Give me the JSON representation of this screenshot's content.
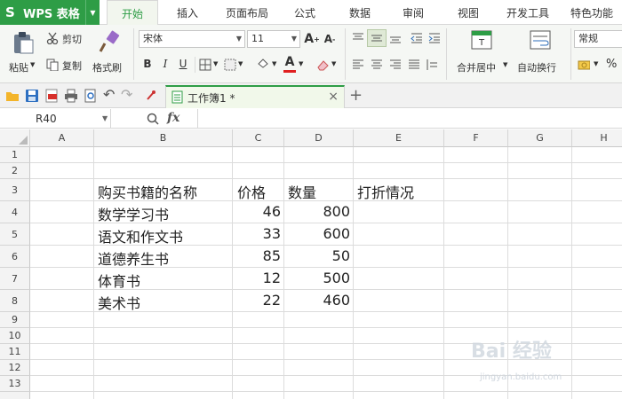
{
  "app": {
    "title": "WPS 表格",
    "logo_letter": "S"
  },
  "menu_tabs": [
    {
      "label": "开始"
    },
    {
      "label": "插入"
    },
    {
      "label": "页面布局"
    },
    {
      "label": "公式"
    },
    {
      "label": "数据"
    },
    {
      "label": "审阅"
    },
    {
      "label": "视图"
    },
    {
      "label": "开发工具"
    },
    {
      "label": "特色功能"
    }
  ],
  "ribbon": {
    "paste": "粘贴",
    "cut": "剪切",
    "copy": "复制",
    "format_painter": "格式刷",
    "font_name": "宋体",
    "font_size": "11",
    "merge_center": "合并居中",
    "wrap_text": "自动换行",
    "number_format": "常规",
    "percent": "%"
  },
  "document_tab": {
    "title": "工作簿1 *"
  },
  "formula_bar": {
    "name_box": "R40",
    "fx": "fx",
    "zoom_icon": "Q"
  },
  "columns": [
    "A",
    "B",
    "C",
    "D",
    "E",
    "F",
    "G",
    "H"
  ],
  "rows": [
    "1",
    "2",
    "3",
    "4",
    "5",
    "6",
    "7",
    "8",
    "9",
    "10",
    "11",
    "12",
    "13"
  ],
  "sheet": {
    "headers": {
      "name": "购买书籍的名称",
      "price": "价格",
      "qty": "数量",
      "discount": "打折情况"
    },
    "records": [
      {
        "name": "数学学习书",
        "price": "46",
        "qty": "800"
      },
      {
        "name": "语文和作文书",
        "price": "33",
        "qty": "600"
      },
      {
        "name": "道德养生书",
        "price": "85",
        "qty": "50"
      },
      {
        "name": "体育书",
        "price": "12",
        "qty": "500"
      },
      {
        "name": "美术书",
        "price": "22",
        "qty": "460"
      }
    ]
  },
  "watermark": {
    "text": "Bai 经验",
    "sub": "jingyan.baidu.com"
  },
  "colors": {
    "brand": "#2e9d46",
    "ribbon_bg": "#f5f7f4"
  }
}
